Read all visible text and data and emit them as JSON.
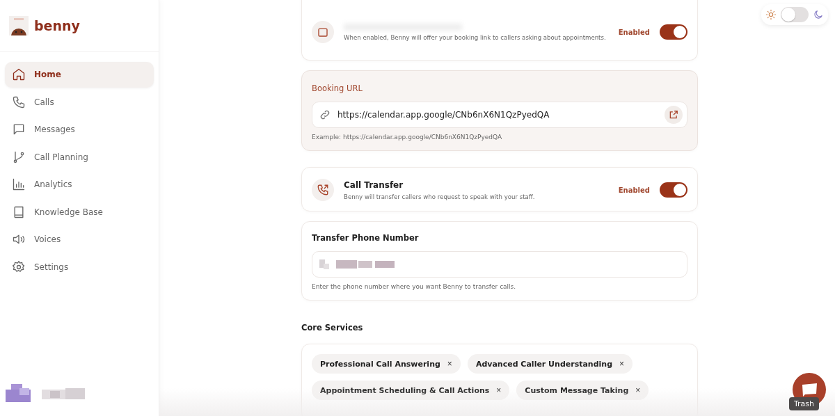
{
  "brand": {
    "name": "benny"
  },
  "sidebar": {
    "items": [
      {
        "label": "Home",
        "selected": true
      },
      {
        "label": "Calls",
        "selected": false
      },
      {
        "label": "Messages",
        "selected": false
      },
      {
        "label": "Call Planning",
        "selected": false
      },
      {
        "label": "Analytics",
        "selected": false
      },
      {
        "label": "Knowledge Base",
        "selected": false
      },
      {
        "label": "Voices",
        "selected": false
      },
      {
        "label": "Settings",
        "selected": false
      }
    ]
  },
  "theme_toggle": {
    "dark": false
  },
  "booking_card": {
    "description": "When enabled, Benny will offer your booking link to callers asking about appointments.",
    "status": "Enabled",
    "on": true
  },
  "booking_url": {
    "label": "Booking URL",
    "value": "https://calendar.app.google/CNb6nX6N1QzPyedQA",
    "hint": "Example: https://calendar.app.google/CNb6nX6N1QzPyedQA"
  },
  "call_transfer": {
    "title": "Call Transfer",
    "description": "Benny will transfer callers who request to speak with your staff.",
    "status": "Enabled",
    "on": true
  },
  "transfer_phone": {
    "label": "Transfer Phone Number",
    "hint": "Enter the phone number where you want Benny to transfer calls."
  },
  "core_services": {
    "title": "Core Services",
    "tags": [
      "Professional Call Answering",
      "Advanced Caller Understanding",
      "Appointment Scheduling & Call Actions",
      "Custom Message Taking"
    ],
    "remove_glyph": "×"
  },
  "tooltip": "Trash"
}
